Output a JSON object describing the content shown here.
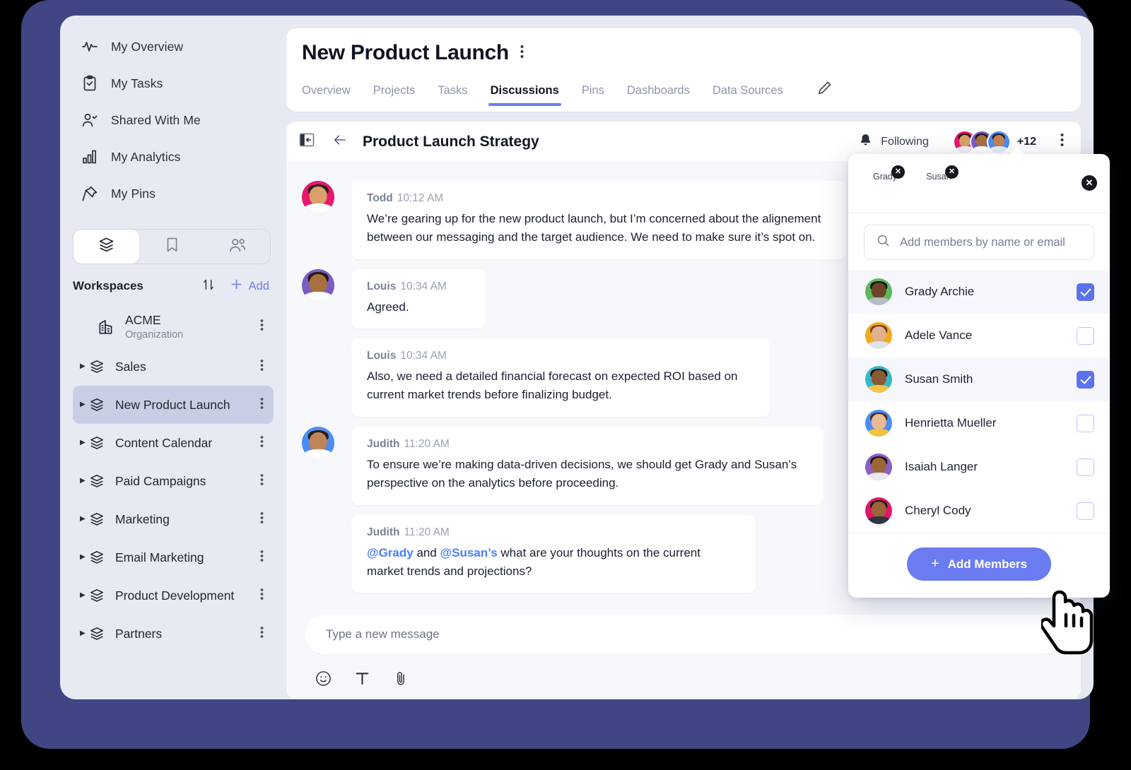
{
  "sidebar": {
    "nav": [
      {
        "label": "My Overview",
        "icon": "activity-icon"
      },
      {
        "label": "My Tasks",
        "icon": "clipboard-check-icon"
      },
      {
        "label": "Shared With Me",
        "icon": "user-check-icon"
      },
      {
        "label": "My Analytics",
        "icon": "bar-chart-icon"
      },
      {
        "label": "My Pins",
        "icon": "pin-icon"
      }
    ],
    "tabs": [
      {
        "name": "layers-tab",
        "icon": "layers-icon",
        "active": true
      },
      {
        "name": "bookmarks-tab",
        "icon": "bookmark-icon",
        "active": false
      },
      {
        "name": "people-tab",
        "icon": "people-icon",
        "active": false
      }
    ],
    "workspaces_header": {
      "title": "Workspaces",
      "sort_icon": "sort-arrows-icon",
      "add_icon": "plus-icon",
      "add_label": "Add"
    },
    "workspaces": [
      {
        "name": "ACME",
        "subtitle": "Organization",
        "icon": "building-icon",
        "selected": false,
        "expandable": false
      },
      {
        "name": "Sales",
        "icon": "layers-icon",
        "selected": false,
        "expandable": true
      },
      {
        "name": "New Product Launch",
        "icon": "layers-icon",
        "selected": true,
        "expandable": true
      },
      {
        "name": "Content Calendar",
        "icon": "layers-icon",
        "selected": false,
        "expandable": true
      },
      {
        "name": "Paid Campaigns",
        "icon": "layers-icon",
        "selected": false,
        "expandable": true
      },
      {
        "name": "Marketing",
        "icon": "layers-icon",
        "selected": false,
        "expandable": true
      },
      {
        "name": "Email Marketing",
        "icon": "layers-icon",
        "selected": false,
        "expandable": true
      },
      {
        "name": "Product Development",
        "icon": "layers-icon",
        "selected": false,
        "expandable": true
      },
      {
        "name": "Partners",
        "icon": "layers-icon",
        "selected": false,
        "expandable": true
      }
    ]
  },
  "header": {
    "title": "New Product Launch",
    "more_icon": "kebab-menu-icon",
    "tabs": [
      {
        "label": "Overview",
        "active": false
      },
      {
        "label": "Projects",
        "active": false
      },
      {
        "label": "Tasks",
        "active": false
      },
      {
        "label": "Discussions",
        "active": true
      },
      {
        "label": "Pins",
        "active": false
      },
      {
        "label": "Dashboards",
        "active": false
      },
      {
        "label": "Data Sources",
        "active": false
      }
    ],
    "edit_icon": "pencil-icon"
  },
  "discussion": {
    "collapse_icon": "collapse-panel-icon",
    "back_icon": "arrow-left-icon",
    "title": "Product Launch Strategy",
    "bell_icon": "bell-icon",
    "following_label": "Following",
    "avatar_overflow": "+12",
    "more_icon": "kebab-menu-icon",
    "messages": [
      {
        "author": "Todd",
        "time": "10:12 AM",
        "text": "We’re gearing up for the new product launch, but I’m concerned about the alignement between our messaging and the target audience. We need to make sure it’s spot on.",
        "show_avatar": true,
        "avatar_ring": "#e8176e",
        "skin": "#d9a06a",
        "hair": "#2b2118",
        "shirt": "#ffffff"
      },
      {
        "author": "Louis",
        "time": "10:34 AM",
        "text": "Agreed.",
        "show_avatar": true,
        "avatar_ring": "#7a5cc4",
        "skin": "#a9703f",
        "hair": "#241a12",
        "shirt": "#ffffff"
      },
      {
        "author": "Louis",
        "time": "10:34 AM",
        "text": "Also, we need a detailed  financial forecast on expected ROI based on current market trends before finalizing budget.",
        "show_avatar": false,
        "avatar_ring": "#7a5cc4",
        "skin": "#a9703f",
        "hair": "#241a12",
        "shirt": "#ffffff"
      },
      {
        "author": "Judith",
        "time": "11:20 AM",
        "text": "To ensure we’re making data-driven decisions, we should get Grady and Susan’s perspective on the analytics before proceeding.",
        "show_avatar": true,
        "avatar_ring": "#4a8df5",
        "skin": "#c08457",
        "hair": "#2a1d15",
        "shirt": "#ffffff"
      },
      {
        "author": "Judith",
        "time": "11:20 AM",
        "mentions": [
          "@Grady",
          "@Susan’s"
        ],
        "text_before": "",
        "text_middle": " and ",
        "text_after": " what are your thoughts on the current market trends and projections?",
        "show_avatar": false,
        "avatar_ring": "#4a8df5",
        "skin": "#c08457",
        "hair": "#2a1d15",
        "shirt": "#ffffff"
      }
    ],
    "header_avatars": [
      {
        "ring": "#e8176e",
        "skin": "#d9a06a",
        "hair": "#1f1811"
      },
      {
        "ring": "#7a5cc4",
        "skin": "#a9703f",
        "hair": "#1d140d"
      },
      {
        "ring": "#4a8df5",
        "skin": "#c08457",
        "hair": "#2a1d15"
      }
    ],
    "composer": {
      "placeholder": "Type a new message",
      "tools": [
        {
          "icon": "emoji-icon"
        },
        {
          "icon": "text-format-icon"
        },
        {
          "icon": "attachment-icon"
        }
      ]
    }
  },
  "members_popup": {
    "close_icon": "close-circle-icon",
    "chips": [
      {
        "name": "Grady",
        "remove_icon": "remove-chip-icon",
        "ring": "#5cb85c",
        "skin": "#6b4429",
        "hair": "#17120e",
        "shirt": "#b9bcc4"
      },
      {
        "name": "Susan",
        "remove_icon": "remove-chip-icon",
        "ring": "#39b6c8",
        "skin": "#8a5a33",
        "hair": "#1a1310",
        "shirt": "#f3c44b"
      }
    ],
    "search": {
      "icon": "search-icon",
      "placeholder": "Add members by name or email",
      "value": ""
    },
    "members": [
      {
        "name": "Grady Archie",
        "checked": true,
        "ring": "#5cb85c",
        "skin": "#6b4429",
        "hair": "#17120e",
        "shirt": "#b9bcc4"
      },
      {
        "name": "Adele Vance",
        "checked": false,
        "ring": "#f2a91c",
        "skin": "#e2b08c",
        "hair": "#6f3f1e",
        "shirt": "#dfe3ea"
      },
      {
        "name": "Susan Smith",
        "checked": true,
        "ring": "#39b6c8",
        "skin": "#8a5a33",
        "hair": "#1a1310",
        "shirt": "#f3c44b"
      },
      {
        "name": "Henrietta Mueller",
        "checked": false,
        "ring": "#4a8df5",
        "skin": "#e8bb96",
        "hair": "#4a2a16",
        "shirt": "#f0c23c"
      },
      {
        "name": "Isaiah Langer",
        "checked": false,
        "ring": "#8b5fc4",
        "skin": "#9a6637",
        "hair": "#1b1310",
        "shirt": "#e7eaf0"
      },
      {
        "name": "Cheryl Cody",
        "checked": false,
        "ring": "#e0166b",
        "skin": "#9c6436",
        "hair": "#18110d",
        "shirt": "#2f3542"
      }
    ],
    "add_button": {
      "label": "Add Members",
      "plus": "+",
      "icon": "plus-icon"
    }
  },
  "cursor": {
    "icon": "hand-pointer-cursor"
  },
  "colors": {
    "frame": "#3f4683",
    "app_bg": "#e7eaf3",
    "accent": "#6b7cf0",
    "mention": "#4a7dfc",
    "checkbox_checked": "#5b72ee",
    "panel_bg": "#f7f8fc",
    "selected_ws": "#c9cee4"
  }
}
